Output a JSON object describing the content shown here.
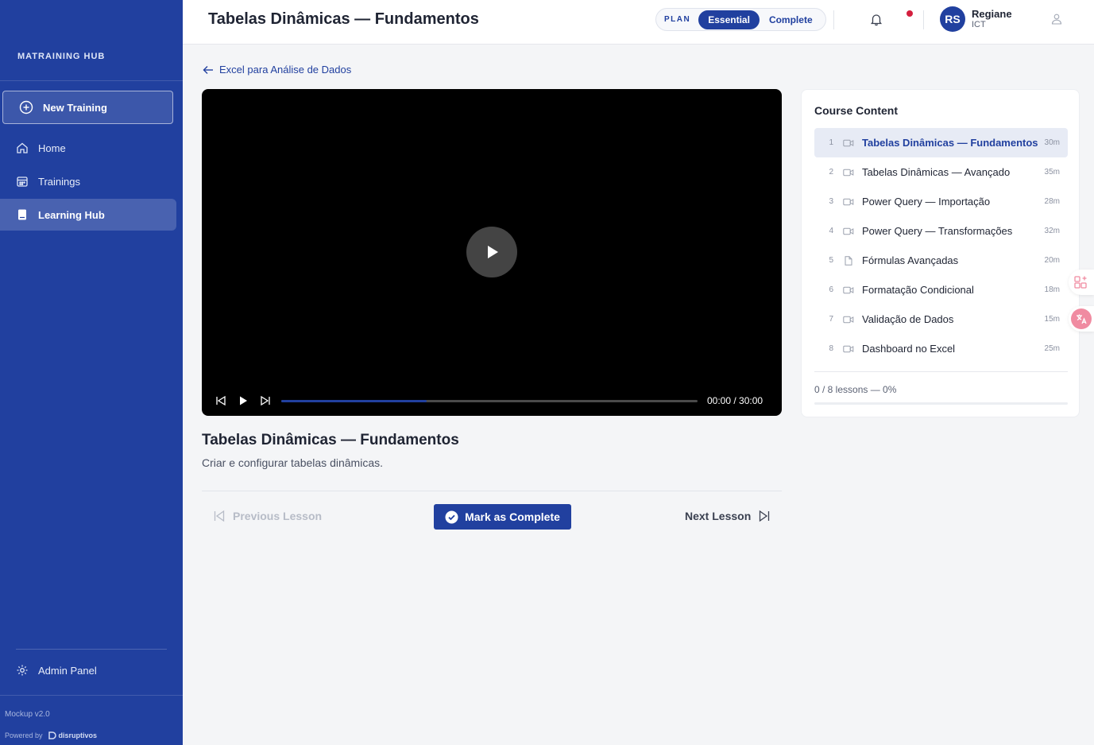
{
  "sidebar": {
    "brand": "MATRAINING HUB",
    "new_training": "New Training",
    "nav": [
      {
        "label": "Home",
        "icon": "home-icon"
      },
      {
        "label": "Trainings",
        "icon": "calendar-icon"
      },
      {
        "label": "Learning Hub",
        "icon": "book-icon",
        "active": true
      }
    ],
    "admin": "Admin Panel",
    "version": "Mockup v2.0",
    "powered_by": "Powered by",
    "powered_logo": "disruptivos"
  },
  "header": {
    "title": "Tabelas Dinâmicas — Fundamentos",
    "plan_label": "PLAN",
    "plan_options": [
      "Essential",
      "Complete"
    ],
    "plan_selected": "Essential",
    "user": {
      "initials": "RS",
      "name": "Regiane",
      "org": "ICT"
    }
  },
  "main": {
    "back_link": "Excel para Análise de Dados",
    "video": {
      "time": "00:00 / 30:00",
      "progress_fraction": 0.35
    },
    "lesson_title": "Tabelas Dinâmicas — Fundamentos",
    "lesson_description": "Criar e configurar tabelas dinâmicas.",
    "prev_label": "Previous Lesson",
    "complete_label": "Mark as Complete",
    "next_label": "Next Lesson"
  },
  "course": {
    "title": "Course Content",
    "lessons": [
      {
        "num": "1",
        "name": "Tabelas Dinâmicas — Fundamentos",
        "duration": "30m",
        "type": "video",
        "active": true
      },
      {
        "num": "2",
        "name": "Tabelas Dinâmicas — Avançado",
        "duration": "35m",
        "type": "video"
      },
      {
        "num": "3",
        "name": "Power Query — Importação",
        "duration": "28m",
        "type": "video"
      },
      {
        "num": "4",
        "name": "Power Query — Transformações",
        "duration": "32m",
        "type": "video"
      },
      {
        "num": "5",
        "name": "Fórmulas Avançadas",
        "duration": "20m",
        "type": "document"
      },
      {
        "num": "6",
        "name": "Formatação Condicional",
        "duration": "18m",
        "type": "video"
      },
      {
        "num": "7",
        "name": "Validação de Dados",
        "duration": "15m",
        "type": "video"
      },
      {
        "num": "8",
        "name": "Dashboard no Excel",
        "duration": "25m",
        "type": "video"
      }
    ],
    "progress_text": "0 / 8 lessons — 0%",
    "progress_fraction": 0
  },
  "colors": {
    "primary": "#21409f",
    "alert": "#d41f3e",
    "accent_pink": "#f08ba1"
  }
}
